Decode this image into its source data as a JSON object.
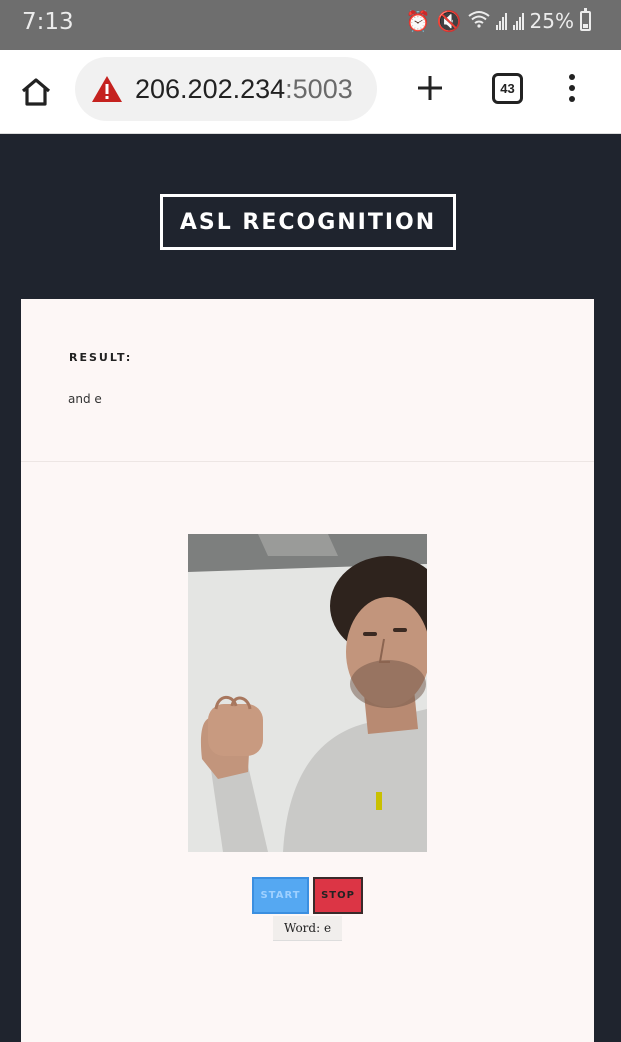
{
  "status_bar": {
    "time": "7:13",
    "battery": "25%",
    "icons": [
      "alarm-icon",
      "mute-icon",
      "wifi-icon",
      "signal-icon",
      "battery-icon"
    ]
  },
  "browser": {
    "url_host": "206.202.234",
    "url_port": ":5003",
    "tab_count": "43",
    "icons": [
      "home-icon",
      "warning-icon",
      "new-tab-icon",
      "tabs-icon",
      "menu-icon"
    ]
  },
  "page": {
    "title": "ASL RECOGNITION",
    "result_label": "RESULT:",
    "result_value": "and e",
    "start_label": "START",
    "stop_label": "STOP",
    "word_text": "Word: e"
  },
  "colors": {
    "page_bg": "#1f242e",
    "card_bg": "#fdf7f6",
    "start_button": "#55a8f2",
    "stop_button": "#dc3545",
    "warning": "#c5221f"
  }
}
